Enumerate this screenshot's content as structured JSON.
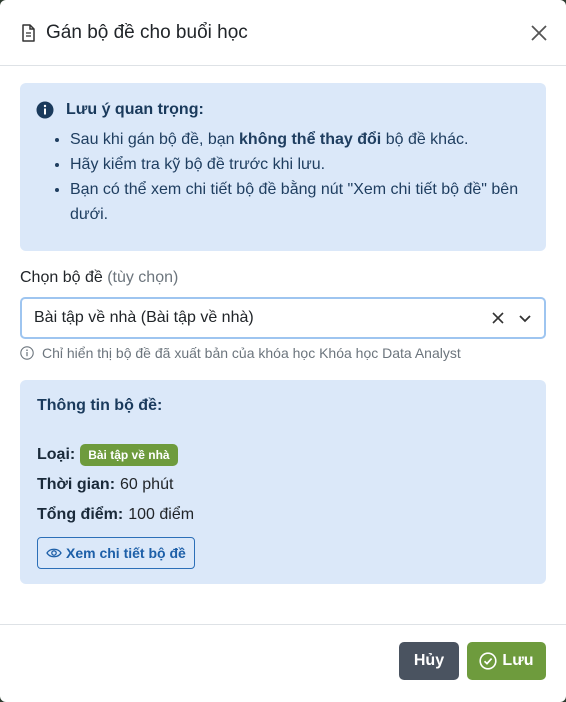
{
  "modal": {
    "title": "Gán bộ đề cho buổi học"
  },
  "alert": {
    "title": "Lưu ý quan trọng:",
    "item1_before": "Sau khi gán bộ đề, bạn ",
    "item1_bold": "không thể thay đổi",
    "item1_after": " bộ đề khác.",
    "item2": "Hãy kiểm tra kỹ bộ đề trước khi lưu.",
    "item3": "Bạn có thể xem chi tiết bộ đề bằng nút \"Xem chi tiết bộ đề\" bên dưới."
  },
  "select": {
    "label": "Chọn bộ đề",
    "optional": "(tùy chọn)",
    "value": "Bài tập về nhà (Bài tập về nhà)",
    "hint": "Chỉ hiển thị bộ đề đã xuất bản của khóa học Khóa học Data Analyst"
  },
  "details": {
    "title": "Thông tin bộ đề:",
    "type_label": "Loại:",
    "type_badge": "Bài tập về nhà",
    "time_label": "Thời gian:",
    "time_value": "60 phút",
    "score_label": "Tổng điểm:",
    "score_value": "100 điểm",
    "view_button": "Xem chi tiết bộ đề"
  },
  "footer": {
    "cancel": "Hủy",
    "save": "Lưu"
  },
  "colors": {
    "alert_bg": "#dbe8f9",
    "primary_green": "#6e9b3d",
    "cancel_gray": "#4a5360",
    "link_blue": "#1d5fa8"
  },
  "icons": [
    "document-icon",
    "close-icon",
    "info-icon",
    "clear-icon",
    "chevron-down-icon",
    "info-outline-icon",
    "eye-icon",
    "check-circle-icon"
  ]
}
